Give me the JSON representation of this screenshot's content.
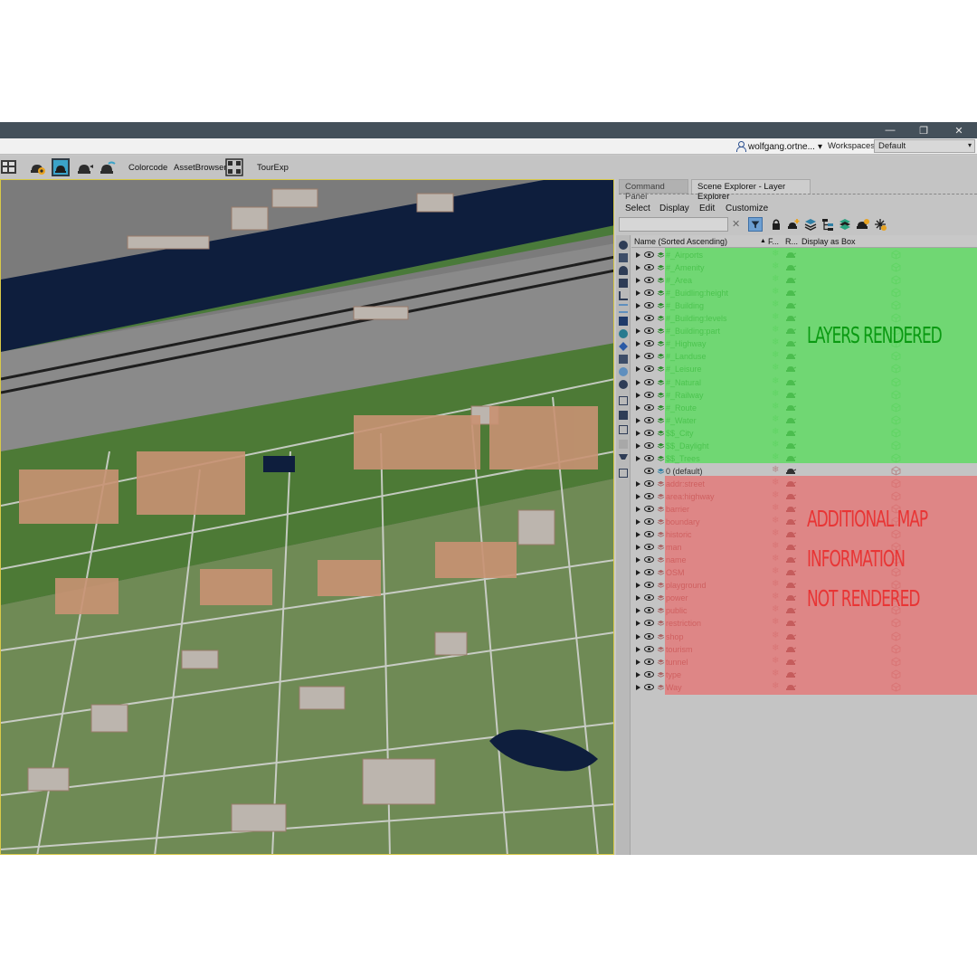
{
  "window": {
    "controls": {
      "minimize": "—",
      "restore": "❐",
      "close": "✕"
    }
  },
  "menu_row": {
    "user_name": "wolfgang.ortne...",
    "user_dropdown": "▾",
    "workspaces_label": "Workspaces:",
    "workspace_value": "Default",
    "workspace_arrow": "▾"
  },
  "toolbar": {
    "colorcode": "Colorcode",
    "asset_browser": "AssetBrowser",
    "tour_exp": "TourExp"
  },
  "panel": {
    "tabs": [
      "Command Panel",
      "Scene Explorer - Layer Explorer"
    ],
    "menu": [
      "Select",
      "Display",
      "Edit",
      "Customize"
    ],
    "search_clear": "✕",
    "columns": {
      "name": "Name (Sorted Ascending)",
      "sort_arrow": "▲",
      "freeze": "F...",
      "render": "R...",
      "box": "Display as Box"
    }
  },
  "layers": {
    "rendered": [
      "#_Airports",
      "#_Amenity",
      "#_Area",
      "#_Buidling:height",
      "#_Building",
      "#_Building:levels",
      "#_Building:part",
      "#_Highway",
      "#_Landuse",
      "#_Leisure",
      "#_Natural",
      "#_Railway",
      "#_Route",
      "#_Water",
      "$$_City",
      "$$_Daylight",
      "$$_Trees"
    ],
    "default": "0 (default)",
    "not_rendered": [
      "addr:street",
      "area:highway",
      "barrier",
      "boundary",
      "historic",
      "man",
      "name",
      "OSM",
      "playground",
      "power",
      "public",
      "restriction",
      "shop",
      "tourism",
      "tunnel",
      "type",
      "Way"
    ]
  },
  "annotations": {
    "rendered": "LAYERS RENDERED",
    "not_rendered": [
      "ADDITIONAL MAP",
      "INFORMATION",
      "NOT RENDERED"
    ]
  },
  "colors": {
    "green_overlay": "#58dc5c",
    "red_overlay": "#e86e6e",
    "annot_green": "#0a9a12",
    "annot_red": "#e83535",
    "titlebar": "#44505a"
  }
}
